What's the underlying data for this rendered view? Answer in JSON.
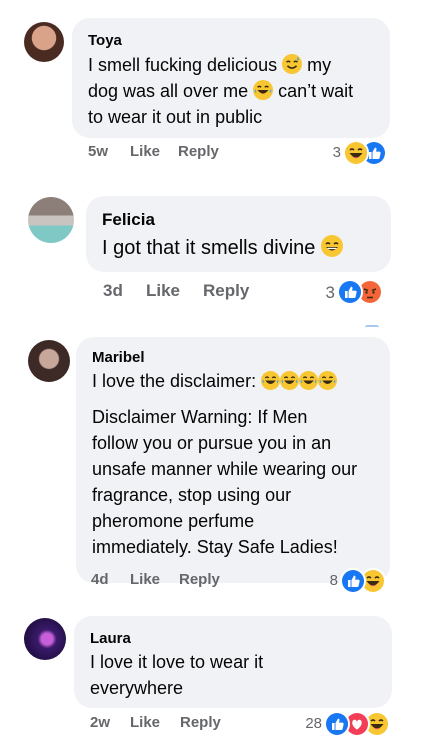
{
  "comments": [
    {
      "author": "Toya",
      "lines": [
        "I smell fucking delicious",
        "my",
        "dog was all over me",
        "can’t wait",
        "to wear it out in public"
      ],
      "time": "5w",
      "like": "Like",
      "reply": "Reply",
      "reaction_count": "3",
      "reactions": [
        "haha-icon",
        "like-icon"
      ],
      "inline_emoji": [
        "sweat-smile-emoji",
        "tears-of-joy-emoji"
      ]
    },
    {
      "author": "Felicia",
      "lines": [
        "I got that it smells divine"
      ],
      "time": "3d",
      "like": "Like",
      "reply": "Reply",
      "reaction_count": "3",
      "reactions": [
        "like-icon",
        "angry-icon"
      ],
      "inline_emoji": [
        "smile-emoji"
      ]
    },
    {
      "author": "Maribel",
      "lines": [
        "I love the disclaimer:",
        "Disclaimer Warning: If Men",
        "follow you or pursue you in an",
        "unsafe manner while wearing our",
        "fragrance, stop using our",
        "pheromone perfume",
        "immediately. Stay Safe Ladies!"
      ],
      "time": "4d",
      "like": "Like",
      "reply": "Reply",
      "reaction_count": "8",
      "reactions": [
        "like-icon",
        "haha-icon"
      ],
      "inline_emoji": [
        "tears-of-joy-emoji",
        "tears-of-joy-emoji",
        "tears-of-joy-emoji",
        "tears-of-joy-emoji"
      ]
    },
    {
      "author": "Laura",
      "lines": [
        "I love it love to wear it",
        "everywhere"
      ],
      "time": "2w",
      "like": "Like",
      "reply": "Reply",
      "reaction_count": "28",
      "reactions": [
        "like-icon",
        "love-icon",
        "haha-icon"
      ]
    }
  ],
  "colors": {
    "bubble": "#f0f2f5",
    "meta_text": "#65676b",
    "like_blue": "#1877f2",
    "love_red": "#f33e58",
    "emoji_yellow": "#f7b928"
  }
}
